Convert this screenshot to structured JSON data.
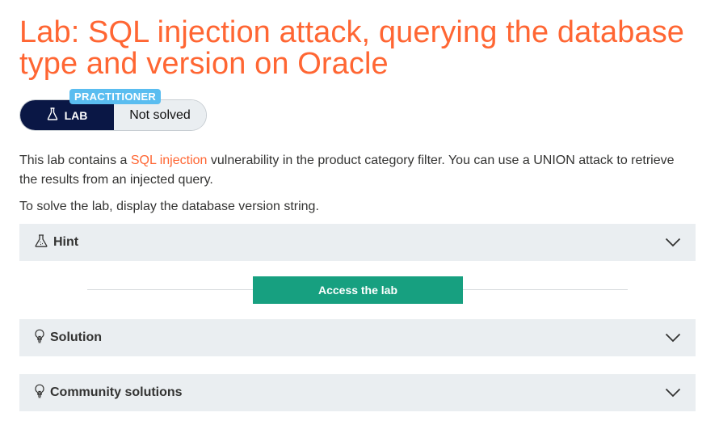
{
  "header": {
    "title": "Lab: SQL injection attack, querying the database type and version on Oracle"
  },
  "lab_widget": {
    "level": "PRACTITIONER",
    "tag": "LAB",
    "status": "Not solved"
  },
  "description": {
    "pre": "This lab contains a ",
    "link": "SQL injection",
    "post": " vulnerability in the product category filter. You can use a UNION attack to retrieve the results from an injected query.",
    "goal": "To solve the lab, display the database version string."
  },
  "sections": {
    "hint": "Hint",
    "solution": "Solution",
    "community": "Community solutions"
  },
  "access_button": "Access the lab",
  "colors": {
    "title": "#ff6633",
    "badge": "#5abdf0",
    "lab_tag": "#0a1745",
    "access": "#17a080",
    "section_bg": "#eaeef1"
  },
  "icons": {
    "lab": "flask-icon",
    "hint": "flask-icon",
    "solution": "lightbulb-icon",
    "community": "lightbulb-icon",
    "expand": "chevron-down-icon"
  }
}
